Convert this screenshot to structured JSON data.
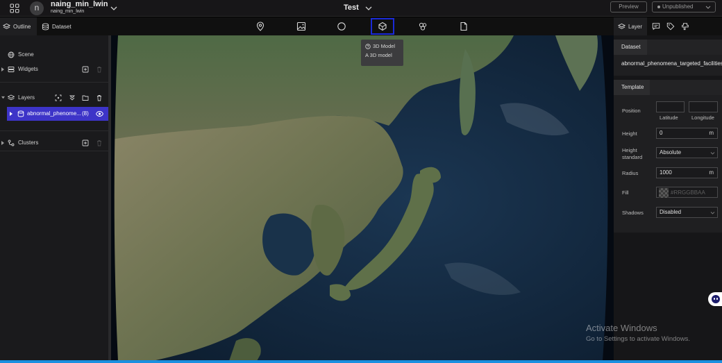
{
  "topbar": {
    "avatar_initial": "n",
    "user_name": "naing_min_lwin",
    "user_sub": "naing_min_lwin",
    "project_title": "Test",
    "preview_label": "Preview",
    "publish_label": "Unpublished"
  },
  "left_tabs": {
    "outline": "Outline",
    "dataset": "Dataset"
  },
  "toolbar": {
    "tools": [
      "marker-icon",
      "image-icon",
      "circle-icon",
      "3d-model-icon",
      "plugin-icon",
      "file-icon"
    ],
    "selected_tool": "3d-model-icon",
    "highlight_color": "#1a2ad8"
  },
  "tooltip": {
    "title": "3D Model",
    "description": "A 3D model"
  },
  "outline": {
    "scene": "Scene",
    "widgets": "Widgets",
    "layers": "Layers",
    "clusters": "Clusters",
    "layer_item": {
      "name": "abnormal_phenome...",
      "count": "(8)",
      "color": "#3d34c8"
    }
  },
  "right_tabs": {
    "layer": "Layer"
  },
  "inspector": {
    "dataset_header": "Dataset",
    "dataset_name": "abnormal_phenomena_targeted_facilities.",
    "template_header": "Template",
    "position_label": "Position",
    "latitude_label": "Latitude",
    "longitude_label": "Longitude",
    "height_label": "Height",
    "height_value": "0",
    "height_unit": "m",
    "height_standard_label_1": "Height",
    "height_standard_label_2": "standard",
    "height_standard_value": "Absolute",
    "radius_label": "Radius",
    "radius_value": "1000",
    "radius_unit": "m",
    "fill_label": "Fill",
    "fill_placeholder": "#RRGGBBAA",
    "shadows_label": "Shadows",
    "shadows_value": "Disabled"
  },
  "watermark": {
    "line1": "Activate Windows",
    "line2": "Go to Settings to activate Windows."
  }
}
